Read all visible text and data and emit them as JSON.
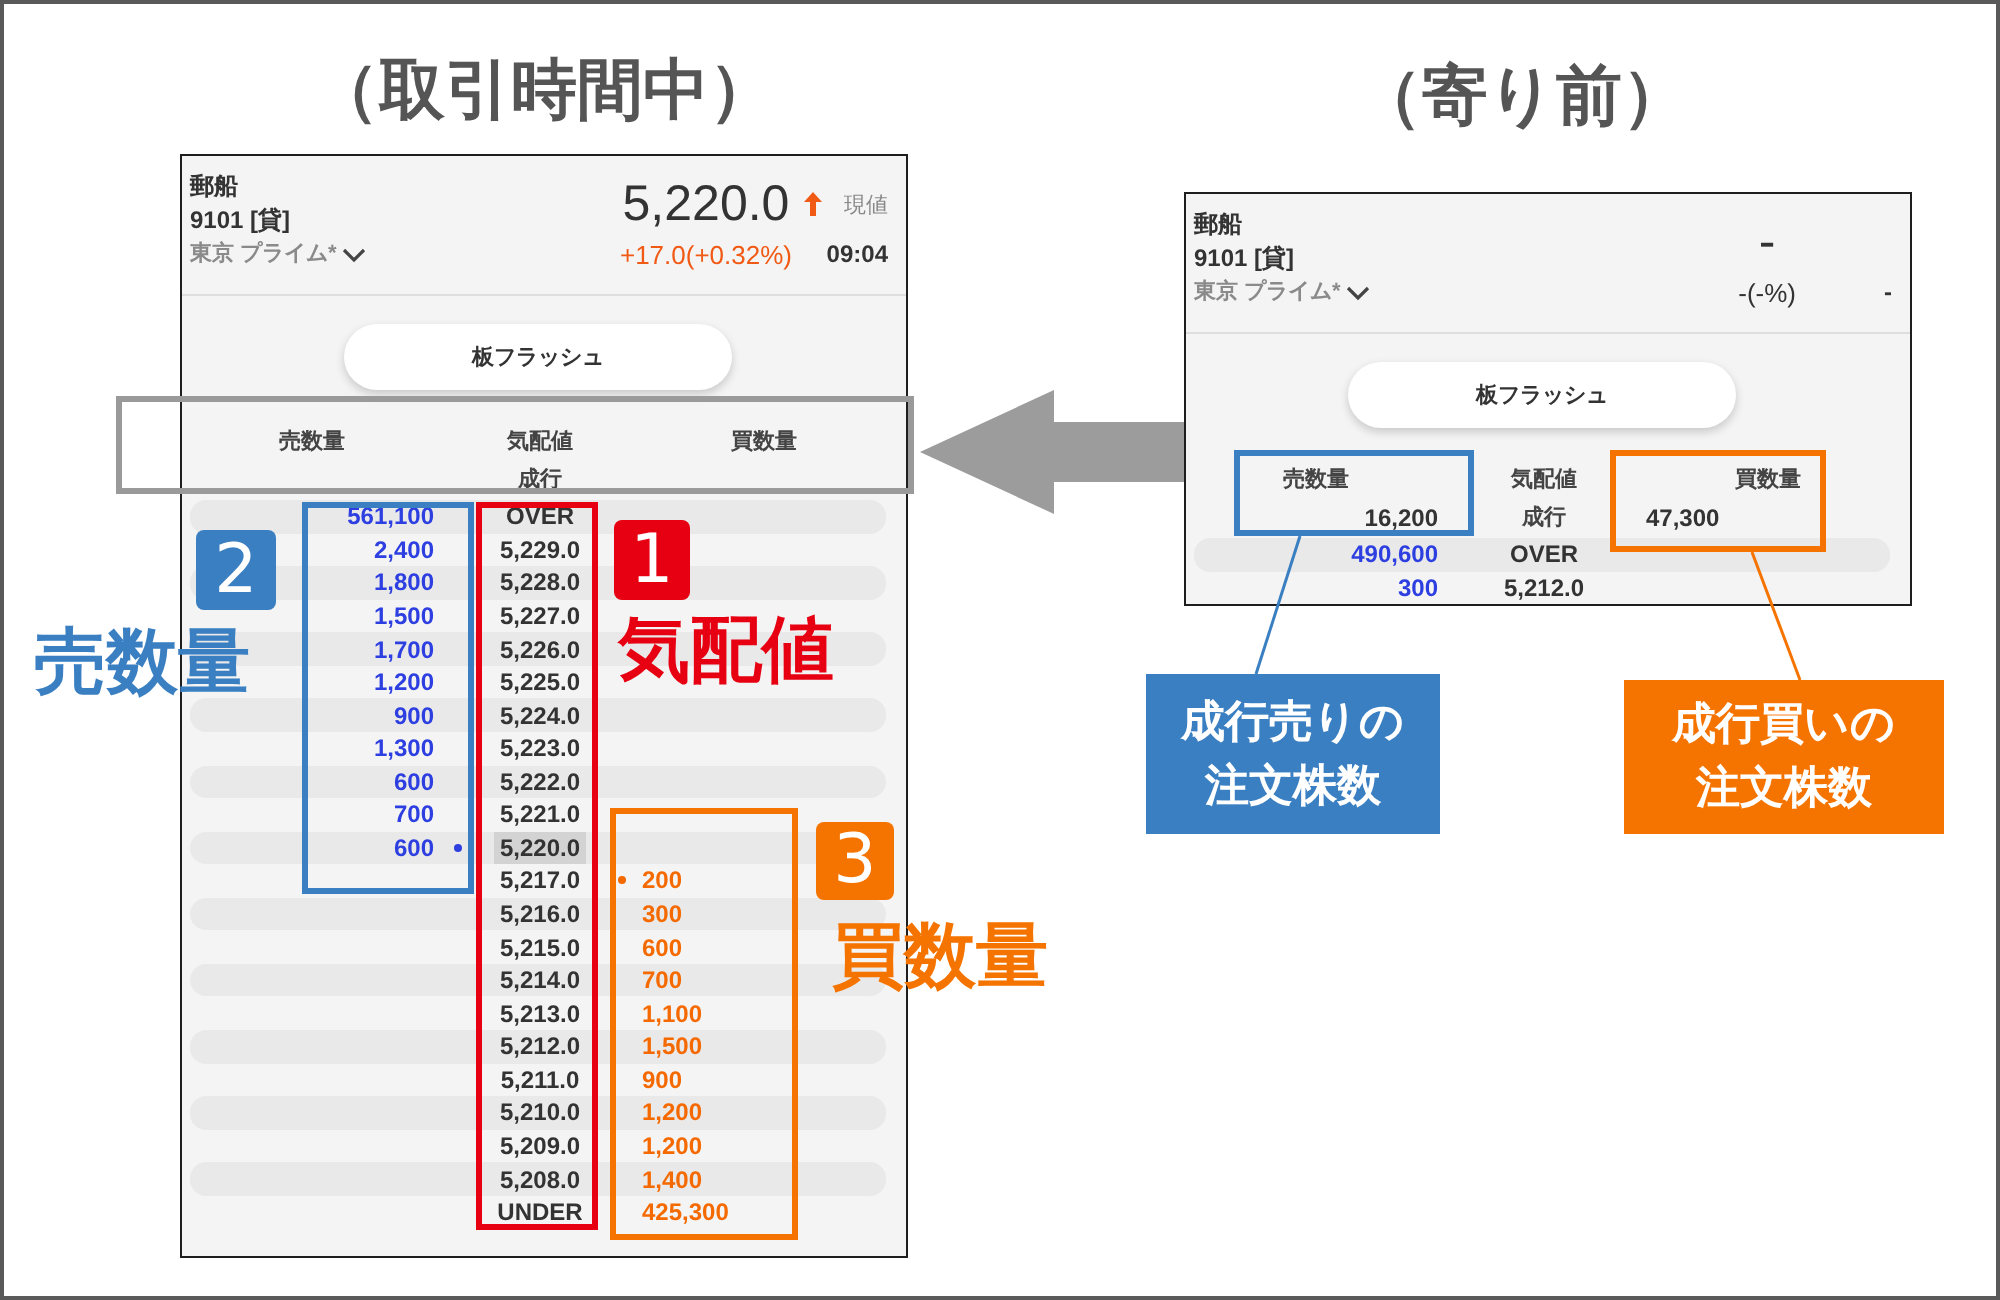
{
  "views": [
    {
      "title": "（取引時間中）",
      "quote": {
        "name": "郵船",
        "code": "9101 [貸]",
        "market": "東京 プライム*",
        "price": "5,220.0",
        "price_up": true,
        "price_label": "現値",
        "change": "+17.0(+0.32%)",
        "time": "09:04"
      },
      "flash_button": "板フラッシュ",
      "columns": [
        "売数量",
        "気配値",
        "買数量"
      ],
      "market_order": {
        "price": "成行"
      },
      "rows": [
        {
          "sell": "561,100",
          "price": "OVER",
          "current": false,
          "marked": false
        },
        {
          "sell": "2,400",
          "price": "5,229.0",
          "current": false,
          "marked": false
        },
        {
          "sell": "1,800",
          "price": "5,228.0",
          "current": false,
          "marked": false
        },
        {
          "sell": "1,500",
          "price": "5,227.0",
          "current": false,
          "marked": false
        },
        {
          "sell": "1,700",
          "price": "5,226.0",
          "current": false,
          "marked": false
        },
        {
          "sell": "1,200",
          "price": "5,225.0",
          "current": false,
          "marked": false
        },
        {
          "sell": "900",
          "price": "5,224.0",
          "current": false,
          "marked": false
        },
        {
          "sell": "1,300",
          "price": "5,223.0",
          "current": false,
          "marked": false
        },
        {
          "sell": "600",
          "price": "5,222.0",
          "current": false,
          "marked": false
        },
        {
          "sell": "700",
          "price": "5,221.0",
          "current": false,
          "marked": false
        },
        {
          "sell": "600",
          "price": "5,220.0",
          "current": true,
          "marked": true
        },
        {
          "price": "5,217.0",
          "buy": "200",
          "current": false,
          "marked": true
        },
        {
          "price": "5,216.0",
          "buy": "300",
          "current": false,
          "marked": false
        },
        {
          "price": "5,215.0",
          "buy": "600",
          "current": false,
          "marked": false
        },
        {
          "price": "5,214.0",
          "buy": "700",
          "current": false,
          "marked": false
        },
        {
          "price": "5,213.0",
          "buy": "1,100",
          "current": false,
          "marked": false
        },
        {
          "price": "5,212.0",
          "buy": "1,500",
          "current": false,
          "marked": false
        },
        {
          "price": "5,211.0",
          "buy": "900",
          "current": false,
          "marked": false
        },
        {
          "price": "5,210.0",
          "buy": "1,200",
          "current": false,
          "marked": false
        },
        {
          "price": "5,209.0",
          "buy": "1,200",
          "current": false,
          "marked": false
        },
        {
          "price": "5,208.0",
          "buy": "1,400",
          "current": false,
          "marked": false
        },
        {
          "price": "UNDER",
          "buy": "425,300",
          "current": false,
          "marked": false
        }
      ]
    },
    {
      "title": "（寄り前）",
      "quote": {
        "name": "郵船",
        "code": "9101 [貸]",
        "market": "東京 プライム*",
        "price": "-",
        "change": "-(-%)",
        "time": "-"
      },
      "flash_button": "板フラッシュ",
      "columns": [
        "売数量",
        "気配値",
        "買数量"
      ],
      "market_order": {
        "sell": "16,200",
        "price": "成行",
        "buy": "47,300"
      },
      "rows": [
        {
          "sell": "490,600",
          "price": "OVER",
          "current": false,
          "marked": false
        },
        {
          "sell": "300",
          "price": "5,212.0",
          "current": false,
          "marked": false
        }
      ]
    }
  ],
  "annotations": {
    "markers": [
      {
        "number": "2",
        "label": "売数量",
        "color": "#3a7fc1"
      },
      {
        "number": "1",
        "label": "気配値",
        "color": "#e60012"
      },
      {
        "number": "3",
        "label": "買数量",
        "color": "#f57400"
      }
    ],
    "callouts": [
      {
        "text": "成行売りの注文株数",
        "color": "#3a7fc1"
      },
      {
        "text": "成行買いの注文株数",
        "color": "#f57400"
      }
    ]
  }
}
